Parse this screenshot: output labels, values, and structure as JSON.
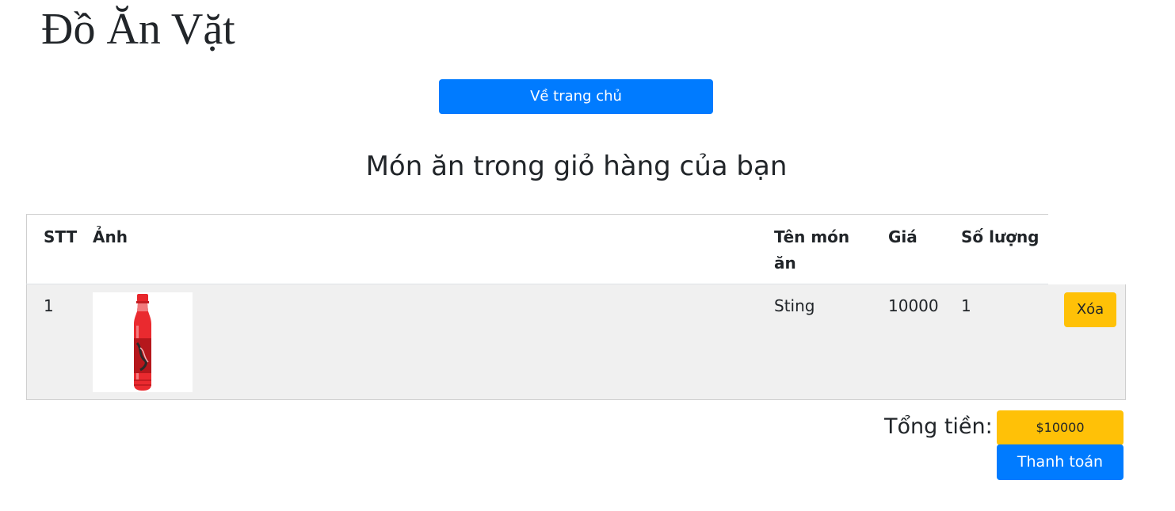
{
  "site": {
    "title": "Đồ Ăn Vặt",
    "home_button_label": "Về trang chủ"
  },
  "cart": {
    "heading": "Món ăn trong giỏ hàng của bạn",
    "columns": {
      "stt": "STT",
      "image": "Ảnh",
      "name": "Tên món ăn",
      "price": "Giá",
      "quantity": "Số lượng"
    },
    "items": [
      {
        "stt": "1",
        "image_icon": "red-soda-bottle-image",
        "name": "Sting",
        "price": "10000",
        "quantity": "1",
        "delete_label": "Xóa"
      }
    ],
    "total_label": "Tổng tiền:",
    "total_value": "$10000",
    "checkout_label": "Thanh toán"
  },
  "colors": {
    "primary": "#007bff",
    "warning": "#ffc107",
    "row_background": "#f0f0f0",
    "product_red": "#e8262b"
  }
}
